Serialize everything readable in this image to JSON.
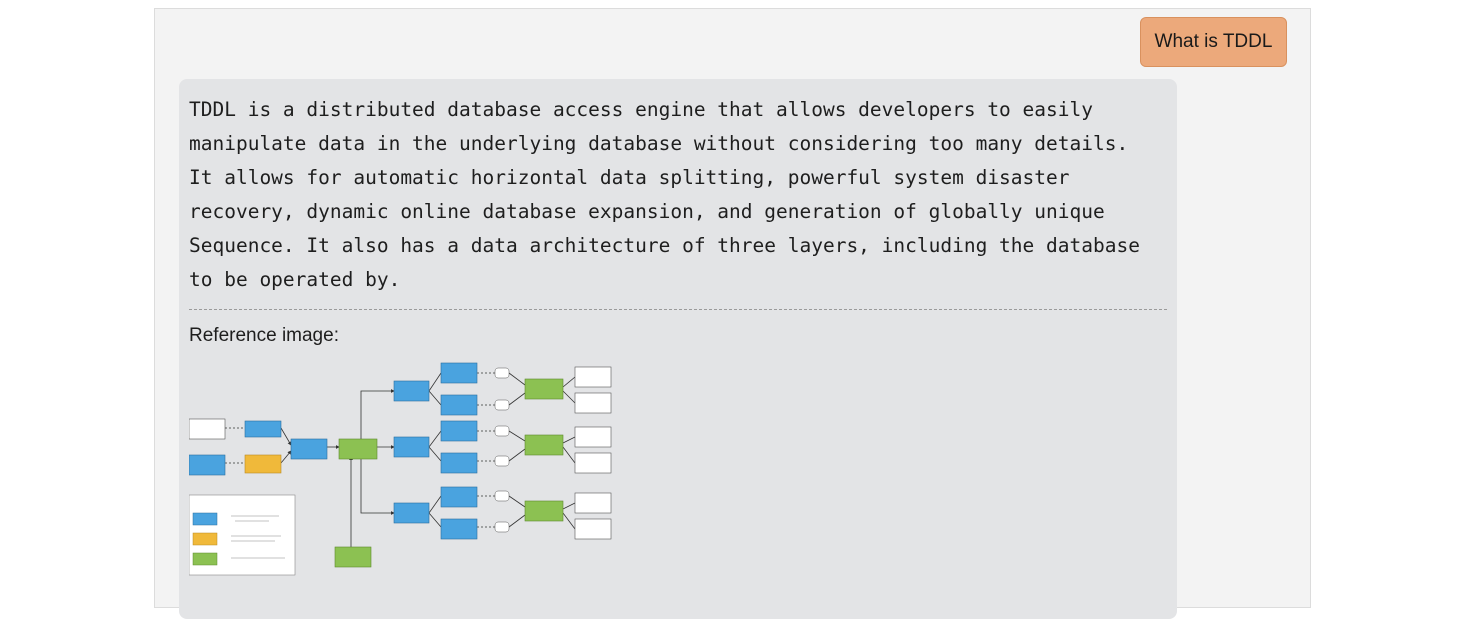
{
  "user_message": {
    "text": "What is TDDL"
  },
  "answer": {
    "paragraph": "TDDL is a distributed database access engine that allows developers to easily\nmanipulate data in the underlying database without considering too many details.\nIt allows for automatic horizontal data splitting, powerful system disaster\nrecovery, dynamic online database expansion, and generation of globally unique\nSequence. It also has a data architecture of three layers, including the database\nto be operated by.",
    "reference_label": "Reference image:"
  },
  "diagram": {
    "colors": {
      "blue": "#4aa3df",
      "yellow": "#f0b93a",
      "green": "#8cc152",
      "white": "#ffffff"
    }
  }
}
